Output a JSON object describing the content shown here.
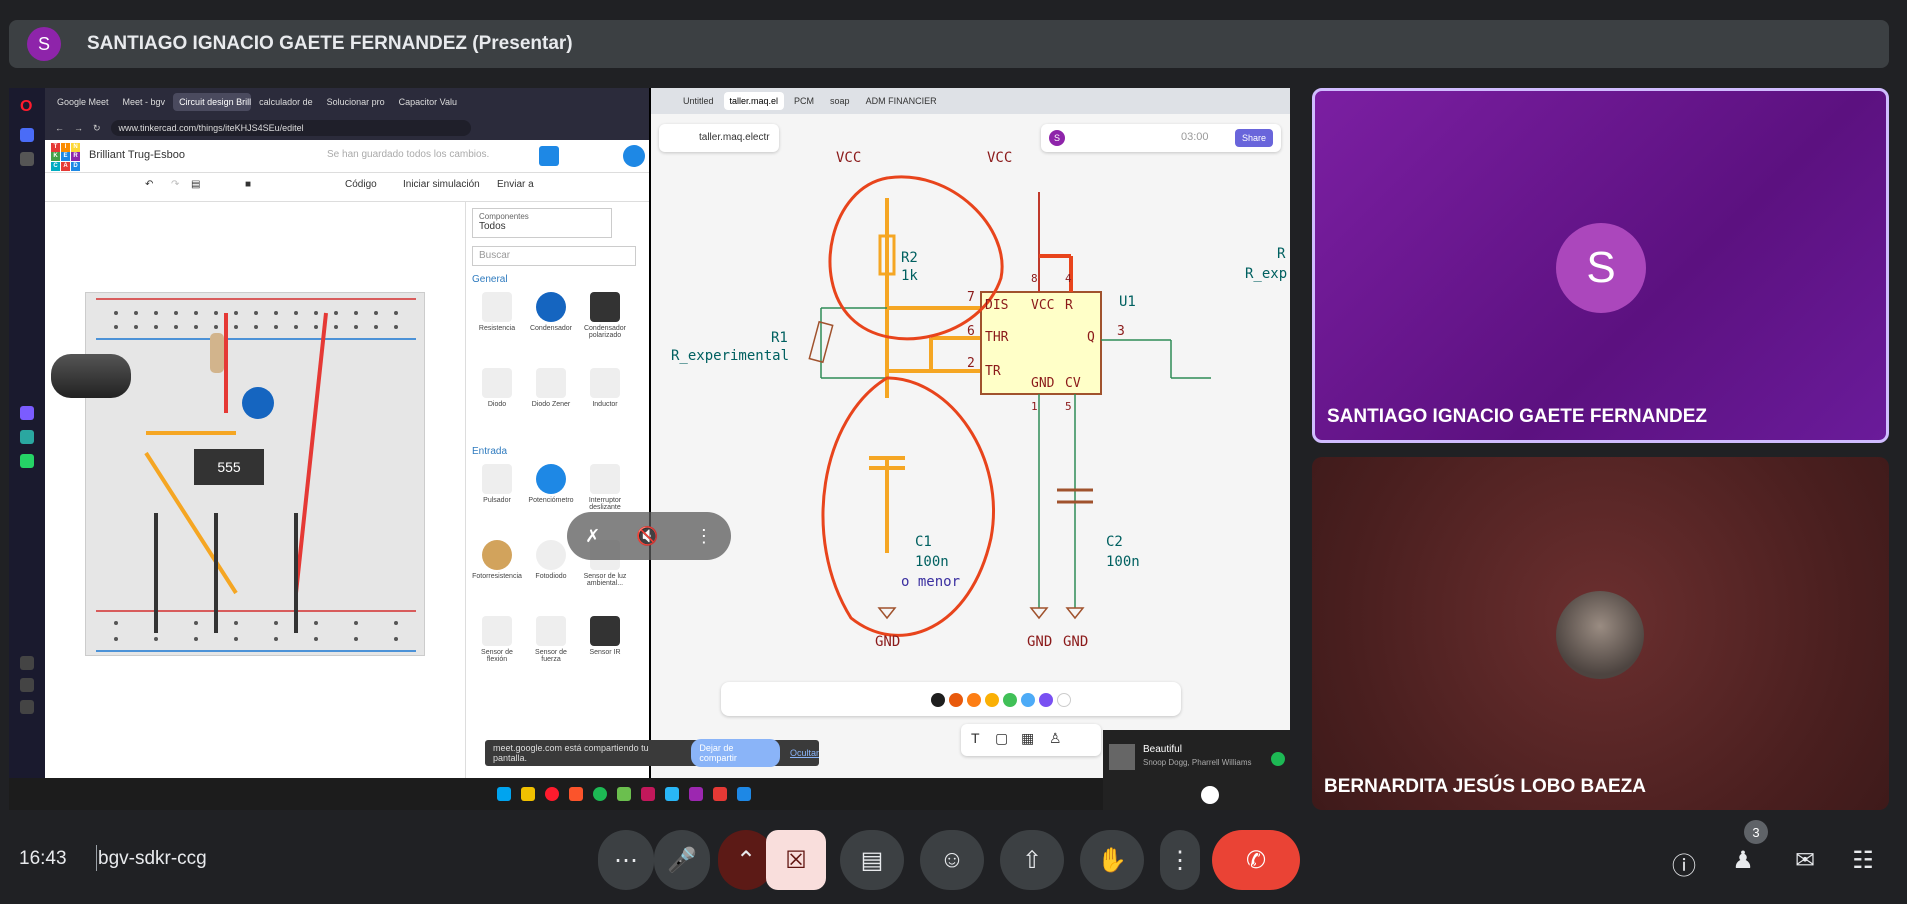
{
  "presenter": {
    "avatar_letter": "S",
    "title": "SANTIAGO IGNACIO GAETE FERNANDEZ (Presentar)"
  },
  "shared_screen": {
    "left_browser": {
      "tabs": [
        "Google Meet",
        "Meet - bgv",
        "Circuit design Brilliant T",
        "calculador de",
        "Solucionar pro",
        "Capacitor Valu"
      ],
      "active_tab_index": 2,
      "url": "www.tinkercad.com/things/iteKHJS4SEu/editel",
      "tinkercad": {
        "logo_letters": [
          "T",
          "I",
          "N",
          "K",
          "E",
          "R",
          "C",
          "A",
          "D"
        ],
        "project_title": "Brilliant Trug-Esboo",
        "saved_status": "Se han guardado todos los cambios.",
        "toolbar": {
          "code": "Código",
          "start_sim": "Iniciar simulación",
          "send_to": "Enviar a"
        },
        "chip_label": "555",
        "panel": {
          "select_label": "Componentes",
          "select_value": "Todos",
          "search_placeholder": "Buscar",
          "categories": {
            "general": "General",
            "input": "Entrada"
          },
          "general_items": [
            "Resistencia",
            "Condensador",
            "Condensador polarizado",
            "Diodo",
            "Diodo Zener",
            "Inductor"
          ],
          "input_items": [
            "Pulsador",
            "Potenciómetro",
            "Interruptor deslizante",
            "Fotorresistencia",
            "Fotodiodo",
            "Sensor de luz ambiental...",
            "Sensor de flexión",
            "Sensor de fuerza",
            "Sensor IR"
          ]
        }
      }
    },
    "right_browser": {
      "tabs": [
        "Untitled",
        "taller.maq.el",
        "PCM",
        "soap",
        "ADM FINANCIER"
      ],
      "active_tab_index": 1,
      "excalidraw": {
        "file_name": "taller.maq.electr",
        "timer": "03:00",
        "share_label": "Share",
        "avatar_letter": "S"
      },
      "schematic": {
        "labels": {
          "vcc_left": "VCC",
          "vcc_right": "VCC",
          "r2_name": "R2",
          "r2_value": "1k",
          "r1_name": "R1",
          "r1_value": "R_experimental",
          "r_exp_edge": "R_exp",
          "r_edge": "R",
          "c1_name": "C1",
          "c1_value": "100n",
          "c1_note": "o menor",
          "c2_name": "C2",
          "c2_value": "100n",
          "u1": "U1",
          "pin_dis": "DIS",
          "pin_thr": "THR",
          "pin_tr": "TR",
          "pin_vcc": "VCC",
          "pin_r": "R",
          "pin_gnd": "GND",
          "pin_cv": "CV",
          "pin_q": "Q",
          "pin7": "7",
          "pin6": "6",
          "pin2": "2",
          "pin3": "3",
          "pin8": "8",
          "pin4": "4",
          "pin1": "1",
          "pin5": "5",
          "gnd1": "GND",
          "gnd2": "GND",
          "gnd3": "GND"
        }
      },
      "palette_colors": [
        "#1e1e1e",
        "#e8590c",
        "#fd7e14",
        "#fab005",
        "#40c057",
        "#4dabf7",
        "#7950f2",
        "#ffffff"
      ]
    },
    "sharing_notice": {
      "text": "meet.google.com está compartiendo tu pantalla.",
      "stop_label": "Dejar de compartir",
      "hide_label": "Ocultar"
    },
    "spotify": {
      "title": "Beautiful",
      "artist": "Snoop Dogg, Pharrell Williams"
    }
  },
  "participants": [
    {
      "name": "SANTIAGO IGNACIO GAETE FERNANDEZ",
      "avatar_letter": "S",
      "active_speaker": true
    },
    {
      "name": "BERNARDITA JESÚS LOBO BAEZA",
      "avatar_letter": "",
      "active_speaker": false
    }
  ],
  "bottom_bar": {
    "time": "16:43",
    "meeting_code": "bgv-sdkr-ccg",
    "participant_count": "3"
  },
  "colors": {
    "background": "#202124",
    "end_call": "#ea4335",
    "speaker_tile": "#7b1fa2",
    "schematic_wire_orange": "#f5a623",
    "annotation_red": "#e8441c"
  }
}
